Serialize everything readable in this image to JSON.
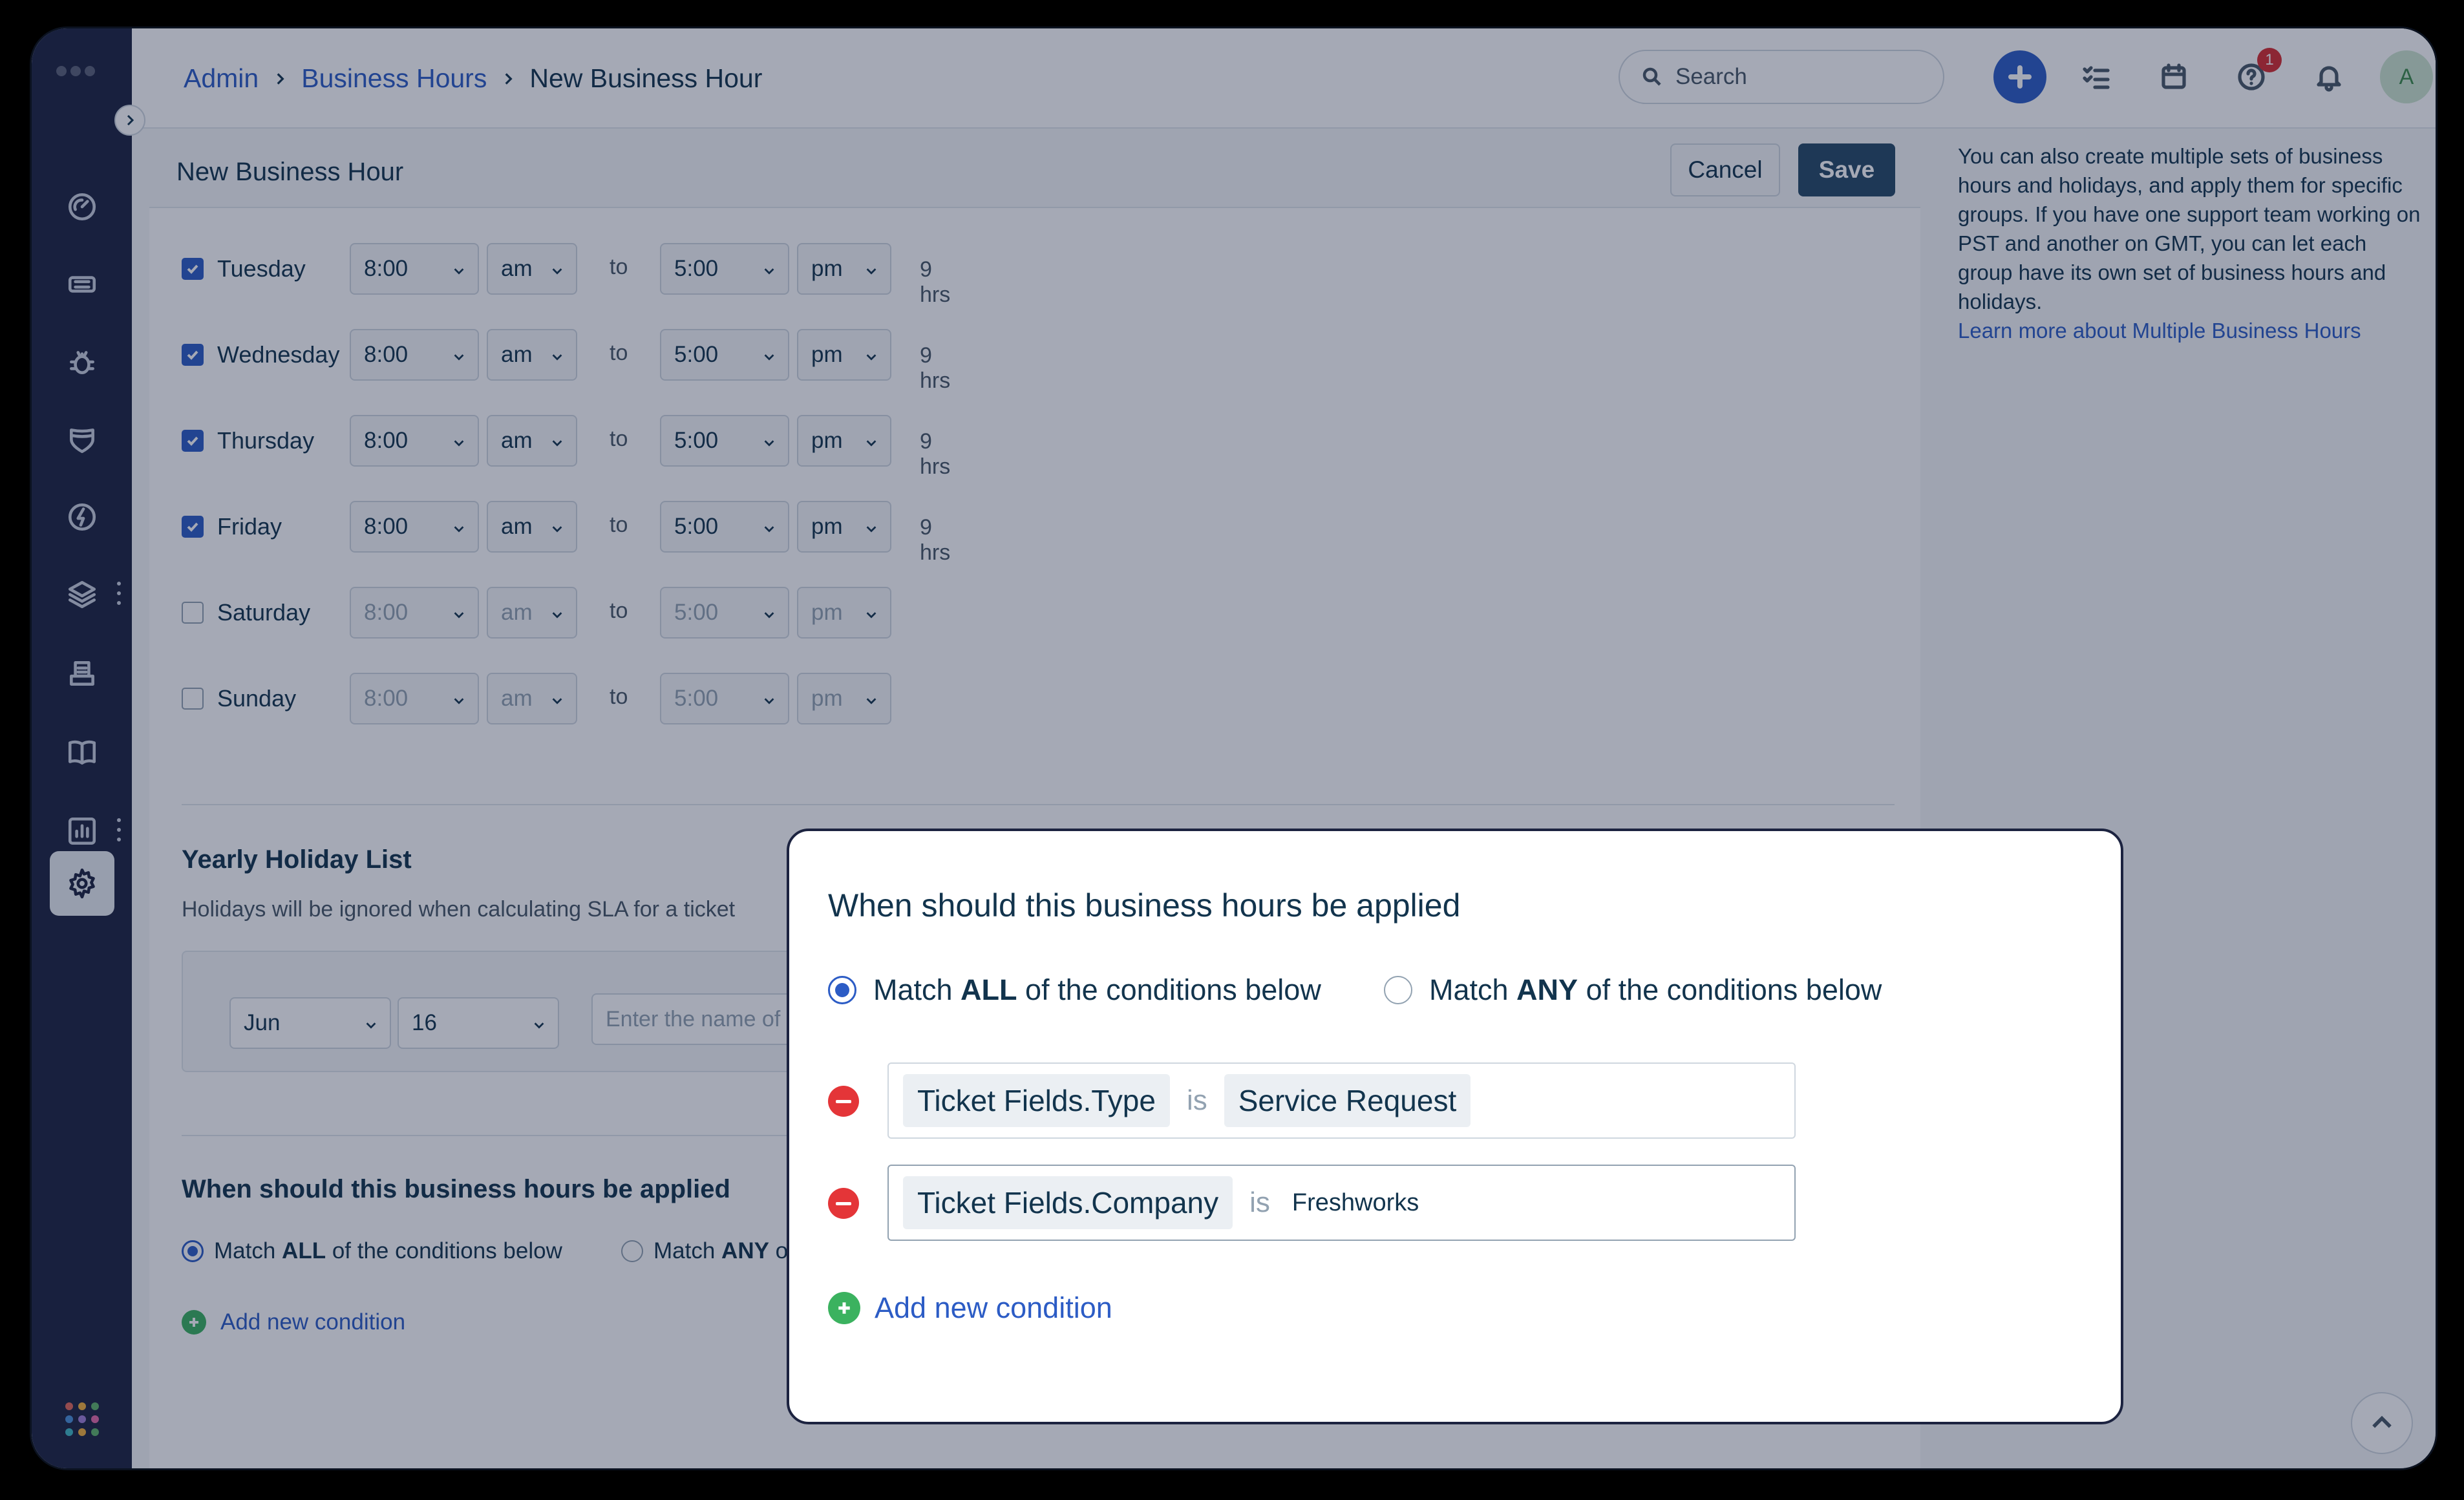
{
  "breadcrumb": {
    "admin": "Admin",
    "business_hours": "Business Hours",
    "current": "New Business Hour"
  },
  "search": {
    "placeholder": "Search"
  },
  "notifications": {
    "help_badge": "1"
  },
  "user": {
    "avatar_initial": "A"
  },
  "page": {
    "title": "New Business Hour",
    "cancel_label": "Cancel",
    "save_label": "Save"
  },
  "days": [
    {
      "label": "Tuesday",
      "checked": true,
      "start": "8:00",
      "start_ampm": "am",
      "to": "to",
      "end": "5:00",
      "end_ampm": "pm",
      "hours": "9 hrs"
    },
    {
      "label": "Wednesday",
      "checked": true,
      "start": "8:00",
      "start_ampm": "am",
      "to": "to",
      "end": "5:00",
      "end_ampm": "pm",
      "hours": "9 hrs"
    },
    {
      "label": "Thursday",
      "checked": true,
      "start": "8:00",
      "start_ampm": "am",
      "to": "to",
      "end": "5:00",
      "end_ampm": "pm",
      "hours": "9 hrs"
    },
    {
      "label": "Friday",
      "checked": true,
      "start": "8:00",
      "start_ampm": "am",
      "to": "to",
      "end": "5:00",
      "end_ampm": "pm",
      "hours": "9 hrs"
    },
    {
      "label": "Saturday",
      "checked": false,
      "start": "8:00",
      "start_ampm": "am",
      "to": "to",
      "end": "5:00",
      "end_ampm": "pm",
      "hours": ""
    },
    {
      "label": "Sunday",
      "checked": false,
      "start": "8:00",
      "start_ampm": "am",
      "to": "to",
      "end": "5:00",
      "end_ampm": "pm",
      "hours": ""
    }
  ],
  "holiday": {
    "title": "Yearly Holiday List",
    "subtitle": "Holidays will be ignored when calculating SLA for a ticket",
    "month": "Jun",
    "day": "16",
    "name_placeholder": "Enter the name of"
  },
  "apply_section": {
    "title": "When should this business hours be applied",
    "match_all_pre": "Match ",
    "match_all_bold": "ALL",
    "match_all_post": " of the conditions below",
    "match_any_pre": "Match ",
    "match_any_bold": "ANY",
    "match_any_post": " of t",
    "add_condition": "Add new condition"
  },
  "help_panel": {
    "text": "You can also create multiple sets of business hours and holidays, and apply them for specific groups. If you have one support team working on PST and another on GMT, you can let each group have its own set of business hours and holidays.",
    "link": "Learn more about Multiple Business Hours"
  },
  "modal": {
    "title": "When should this business hours be applied",
    "match_all_pre": "Match ",
    "match_all_bold": "ALL",
    "match_all_post": " of the conditions below",
    "match_any_pre": "Match ",
    "match_any_bold": "ANY",
    "match_any_post": " of the conditions below",
    "selected_match": "ALL",
    "conditions": [
      {
        "field": "Ticket Fields.Type",
        "operator": "is",
        "value": "Service Request"
      },
      {
        "field": "Ticket Fields.Company",
        "operator": "is",
        "value": "Freshworks"
      }
    ],
    "add_condition": "Add new condition"
  },
  "colors": {
    "sidebar_bg": "#1c2340",
    "primary": "#2c5cc5",
    "save_button": "#264966",
    "remove_red": "#e43538",
    "add_green": "#3bb25f",
    "badge_red": "#d72d30"
  },
  "sidebar_icons": [
    "dashboard-icon",
    "ticket-icon",
    "bug-icon",
    "shield-icon",
    "bolt-icon",
    "layers-icon",
    "inbox-tray-icon",
    "book-icon",
    "bar-chart-icon",
    "gear-icon"
  ]
}
